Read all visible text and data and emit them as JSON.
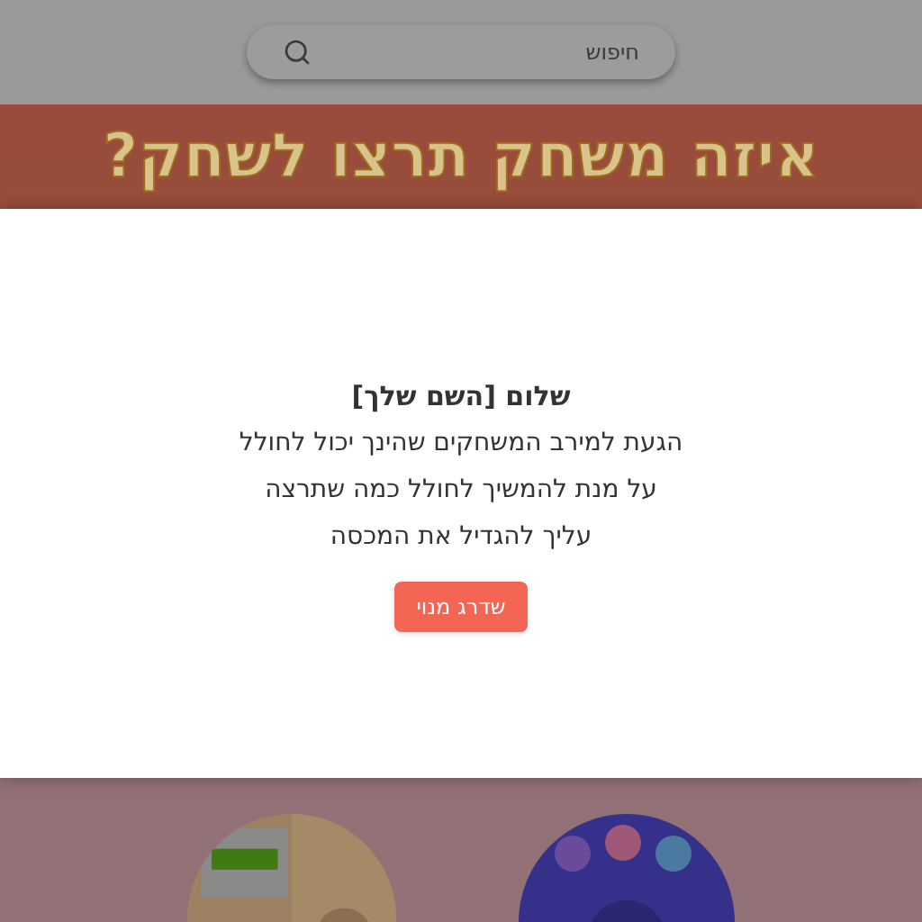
{
  "search": {
    "placeholder": "חיפוש"
  },
  "banner": {
    "headline": "איזה משחק תרצו לשחק?"
  },
  "modal": {
    "greeting": "שלום [השם שלך]",
    "lines": [
      "הגעת למירב המשחקים שהינך יכול לחולל",
      "על מנת להמשיך לחולל כמה שתרצה",
      "עליך להגדיל את המכסה"
    ],
    "button": "שדרג מנוי"
  }
}
